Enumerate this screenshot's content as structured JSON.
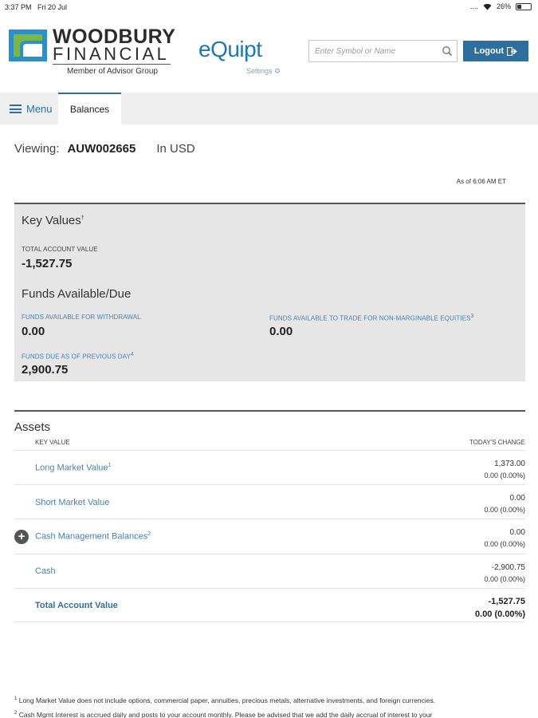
{
  "status_bar": {
    "time": "3:37 PM",
    "date": "Fri 20 Jul",
    "battery": "26%",
    "signal": "....",
    "wifi_icon": "wifi-icon"
  },
  "header": {
    "logo_line1": "WOODBURY",
    "logo_line2": "FINANCIAL",
    "logo_sub": "Member of Advisor Group",
    "app_name": "eQuipt",
    "settings_label": "Settings",
    "search_placeholder": "Enter Symbol or Name",
    "logout_label": "Logout",
    "colors": {
      "brand_blue": "#1e78b4",
      "button_blue": "#2f6f9f",
      "logo_green": "#7ab648",
      "logo_blue": "#2b8fc9"
    }
  },
  "nav": {
    "menu_label": "Menu",
    "active_tab": "Balances"
  },
  "viewing": {
    "label": "Viewing:",
    "account": "AUW002665",
    "currency": "In USD",
    "as_of": "As of 6:06 AM ET"
  },
  "key_values": {
    "title": "Key Values",
    "title_sup": "†",
    "total_label": "TOTAL ACCOUNT VALUE",
    "total_value": "-1,527.75",
    "funds_title": "Funds Available/Due",
    "withdrawal_label": "FUNDS AVAILABLE FOR WITHDRAWAL",
    "withdrawal_value": "0.00",
    "trade_label": "FUNDS AVAILABLE TO TRADE FOR NON-MARGINABLE EQUITIES",
    "trade_sup": "3",
    "trade_value": "0.00",
    "due_label": "FUNDS DUE AS OF PREVIOUS DAY",
    "due_sup": "4",
    "due_value": "2,900.75"
  },
  "assets": {
    "title": "Assets",
    "col_key": "KEY VALUE",
    "col_change": "TODAY'S CHANGE",
    "rows": [
      {
        "name": "Long Market Value",
        "sup": "1",
        "value": "1,373.00",
        "change": "0.00  (0.00%)"
      },
      {
        "name": "Short Market Value",
        "sup": "",
        "value": "0.00",
        "change": "0.00  (0.00%)"
      },
      {
        "name": "Cash Management Balances",
        "sup": "2",
        "value": "0.00",
        "change": "0.00  (0.00%)"
      },
      {
        "name": "Cash",
        "sup": "",
        "value": "-2,900.75",
        "change": "0.00  (0.00%)"
      },
      {
        "name": "Total Account Value",
        "sup": "",
        "value": "-1,527.75",
        "change": "0.00  (0.00%)"
      }
    ]
  },
  "footnotes": {
    "n1_sup": "1",
    "n1": "Long Market Value does not include options, commercial paper, annuities, precious metals, alternative investments, and foreign currencies.",
    "n2_sup": "2",
    "n2": "Cash Mgmt Interest is accrued daily and posts to your account monthly. Please be advised that we add the daily accrual of interest to your"
  }
}
